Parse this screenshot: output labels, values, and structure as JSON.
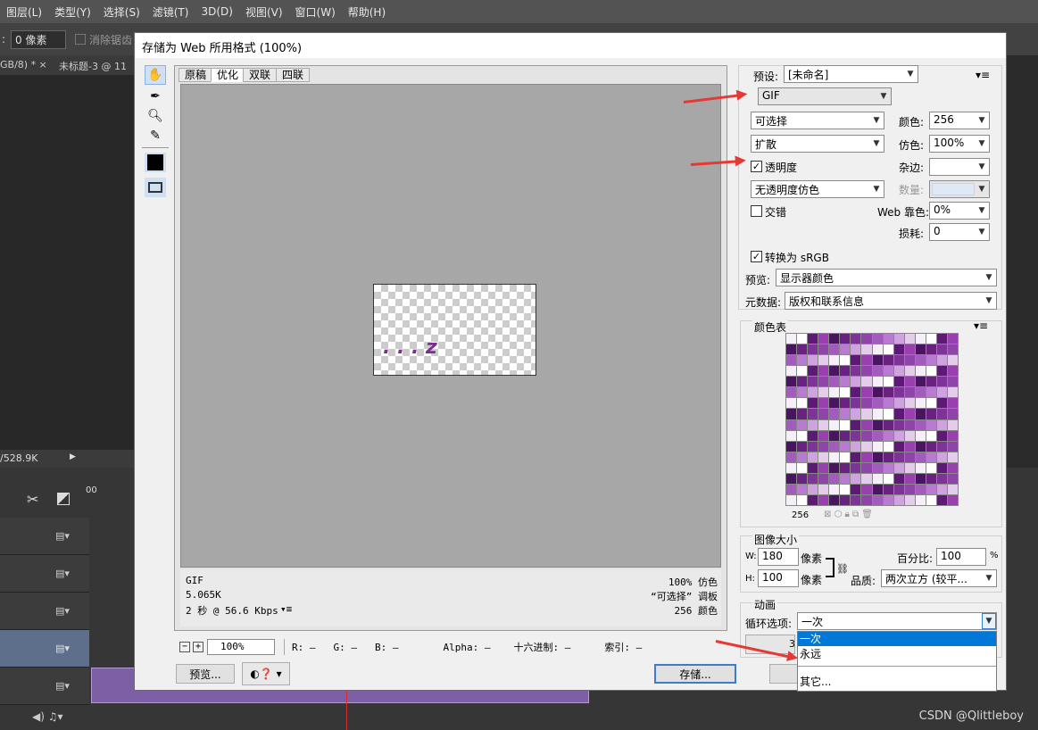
{
  "ps": {
    "menu": [
      "图层(L)",
      "类型(Y)",
      "选择(S)",
      "滤镜(T)",
      "3D(D)",
      "视图(V)",
      "窗口(W)",
      "帮助(H)"
    ],
    "feather_value": "0 像素",
    "antialias_label": "消除锯齿",
    "doc_tab1": "GB/8) * ×",
    "doc_tab2": "未标题-3 @ 11",
    "status_size": "/528.9K",
    "timeline_start": "00"
  },
  "dialog": {
    "title": "存储为 Web 所用格式 (100%)",
    "view_tabs": [
      "原稿",
      "优化",
      "双联",
      "四联"
    ],
    "preview_image_text": ". . . z",
    "info": {
      "format": "GIF",
      "size": "5.065K",
      "speed": "2 秒 @ 56.6 Kbps",
      "dither": "100% 仿色",
      "palette": "“可选择” 调板",
      "colors": "256 颜色"
    },
    "zoom": "100%",
    "readouts": {
      "r": "R: —",
      "g": "G: —",
      "b": "B: —",
      "alpha": "Alpha: —",
      "hex": "十六进制: —",
      "index": "索引: —"
    },
    "preview_button": "预览...",
    "save_button": "存储...",
    "preset_label": "预设:",
    "preset_value": "[未命名]",
    "format_value": "GIF",
    "reduction_value": "可选择",
    "colors_label": "颜色:",
    "colors_value": "256",
    "dither_algo_value": "扩散",
    "dither_label": "仿色:",
    "dither_value": "100%",
    "transparency_label": "透明度",
    "matte_label": "杂边:",
    "trans_dither_value": "无透明度仿色",
    "amount_label": "数量:",
    "interlaced_label": "交错",
    "websnap_label": "Web 靠色:",
    "websnap_value": "0%",
    "lossy_label": "损耗:",
    "lossy_value": "0",
    "convert_srgb_label": "转换为 sRGB",
    "preview_label": "预览:",
    "preview_value": "显示器颜色",
    "metadata_label": "元数据:",
    "metadata_value": "版权和联系信息",
    "color_table_label": "颜色表",
    "color_count": "256",
    "image_size_label": "图像大小",
    "w_label": "W:",
    "w_value": "180",
    "h_label": "H:",
    "h_value": "100",
    "px_unit": "像素",
    "percent_label": "百分比:",
    "percent_value": "100",
    "percent_unit": "%",
    "quality_label": "品质:",
    "quality_value": "两次立方 (较平...",
    "animation_label": "动画",
    "loop_label": "循环选项:",
    "loop_value": "一次",
    "loop_options": [
      "一次",
      "永远",
      "其它..."
    ],
    "partial_num": "3"
  },
  "colors": {
    "accent": "#0078d7",
    "arrow": "#e53935",
    "purple": "#7a2d8f"
  },
  "watermark": "CSDN @Qlittleboy"
}
